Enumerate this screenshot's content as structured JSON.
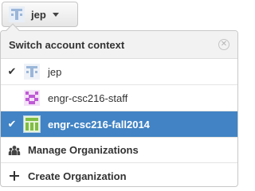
{
  "button": {
    "label": "jep",
    "avatar_icon": "identicon-jep",
    "caret_icon": "caret-down-icon"
  },
  "menu": {
    "title": "Switch account context",
    "close_icon": "close-icon",
    "accounts": [
      {
        "name": "jep",
        "checked": true,
        "selected": false,
        "avatar": "identicon-blue",
        "check_mark": "✔"
      },
      {
        "name": "engr-csc216-staff",
        "checked": false,
        "selected": false,
        "avatar": "identicon-purple",
        "check_mark": ""
      },
      {
        "name": "engr-csc216-fall2014",
        "checked": true,
        "selected": true,
        "avatar": "identicon-green",
        "check_mark": "✔"
      }
    ],
    "actions": [
      {
        "label": "Manage Organizations",
        "icon": "organization-icon"
      },
      {
        "label": "Create Organization",
        "icon": "plus-icon"
      }
    ]
  },
  "colors": {
    "selected_bg": "#4183c4",
    "header_bg": "#f2f2f2",
    "identicon_blue": "#9bb6d9",
    "identicon_purple": "#c05ad6",
    "identicon_green": "#7fbd44"
  }
}
